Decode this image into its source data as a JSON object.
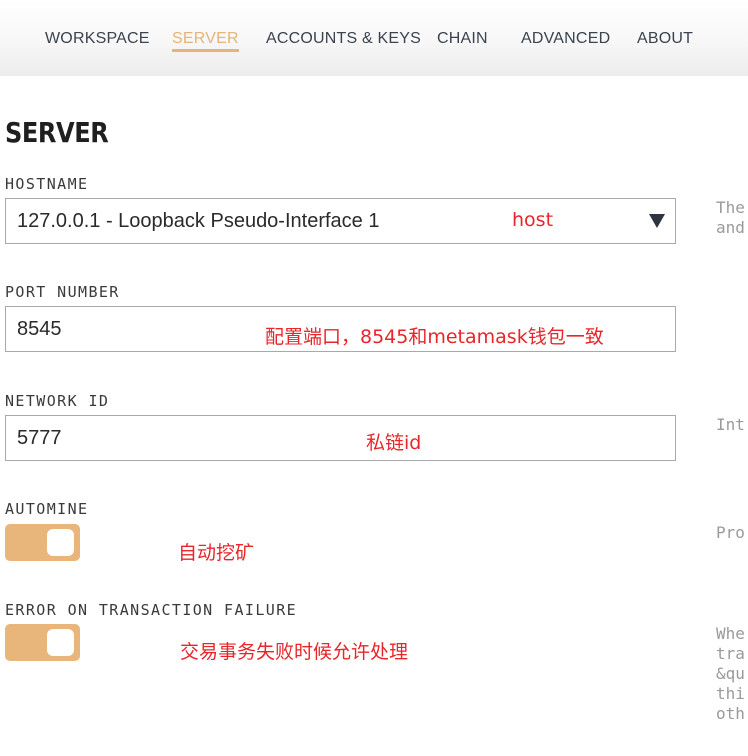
{
  "nav": {
    "items": [
      {
        "label": "WORKSPACE",
        "active": false
      },
      {
        "label": "SERVER",
        "active": true
      },
      {
        "label": "ACCOUNTS & KEYS",
        "active": false
      },
      {
        "label": "CHAIN",
        "active": false
      },
      {
        "label": "ADVANCED",
        "active": false
      },
      {
        "label": "ABOUT",
        "active": false
      }
    ],
    "active_color": "#e4b479"
  },
  "page": {
    "title": "SERVER"
  },
  "hostname": {
    "label": "HOSTNAME",
    "value": "127.0.0.1 - Loopback Pseudo-Interface 1",
    "annotation": "host",
    "help_lines": [
      "The",
      "and"
    ]
  },
  "port": {
    "label": "PORT NUMBER",
    "value": "8545",
    "annotation": "配置端口，8545和metamask钱包一致"
  },
  "network": {
    "label": "NETWORK ID",
    "value": "5777",
    "annotation": "私链id",
    "help_lines": [
      "Int"
    ]
  },
  "automine": {
    "label": "AUTOMINE",
    "enabled": true,
    "annotation": "自动挖矿",
    "help_lines": [
      "Pro"
    ]
  },
  "error_on_failure": {
    "label": "ERROR ON TRANSACTION FAILURE",
    "enabled": true,
    "annotation": "交易事务失败时候允许处理",
    "help_lines": [
      "Whe",
      "tra",
      "&qu",
      "thi",
      "oth"
    ]
  },
  "colors": {
    "toggle_on": "#e8b57a",
    "annotation": "#e8252a"
  }
}
